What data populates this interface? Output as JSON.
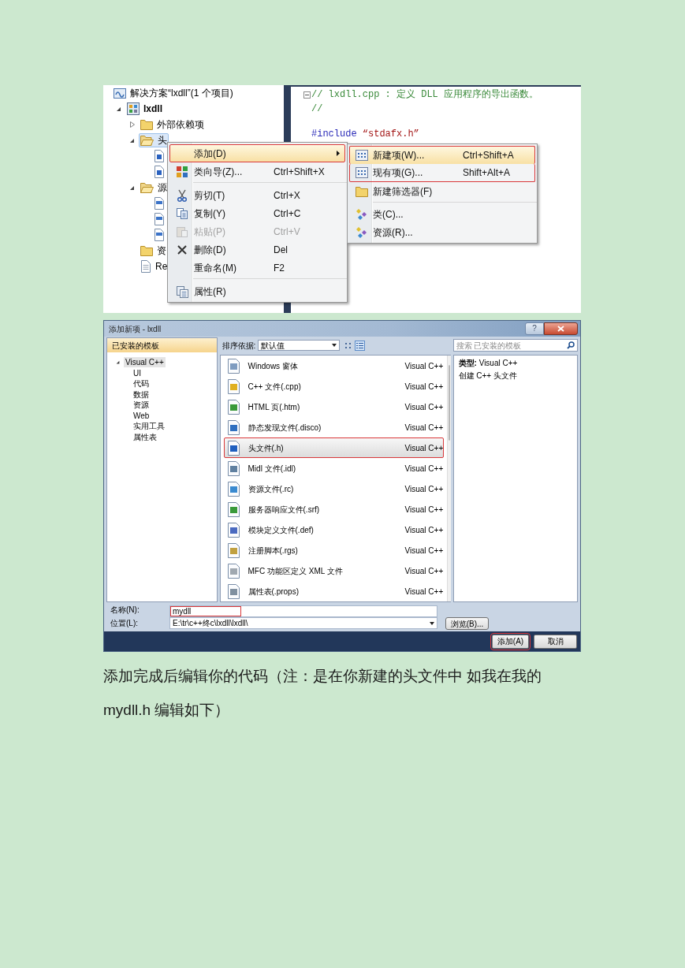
{
  "solution_explorer": {
    "items": [
      {
        "kind": "solution",
        "label": "解决方案“lxdll”(1 个项目)",
        "selected": false,
        "children": [
          {
            "kind": "project",
            "label": "lxdll",
            "expanded": true,
            "selected": false,
            "children": [
              {
                "kind": "folder",
                "label": "外部依赖项",
                "expanded": false,
                "selected": false
              },
              {
                "kind": "folder",
                "label": "头",
                "expanded": true,
                "selected": true,
                "children": [
                  {
                    "kind": "header",
                    "selected": false
                  },
                  {
                    "kind": "header",
                    "selected": false
                  }
                ]
              },
              {
                "kind": "folder",
                "label": "源",
                "expanded": true,
                "selected": false,
                "children": [
                  {
                    "kind": "cpp",
                    "selected": false
                  },
                  {
                    "kind": "cpp",
                    "selected": false
                  },
                  {
                    "kind": "cpp",
                    "selected": false
                  }
                ]
              },
              {
                "kind": "folder",
                "label": "资",
                "selected": false
              },
              {
                "kind": "file",
                "label": "Re",
                "selected": false
              }
            ]
          }
        ]
      }
    ]
  },
  "editor": {
    "lines": [
      {
        "kind": "comment",
        "text": "// lxdll.cpp : 定义 DLL 应用程序的导出函数。",
        "foldable": true
      },
      {
        "kind": "comment",
        "text": "//"
      },
      {
        "kind": "include",
        "keyword": "#include",
        "text": "“stdafx.h”"
      }
    ]
  },
  "context_menu": {
    "items": [
      {
        "kind": "submenu",
        "label": "添加(D)",
        "selected": true,
        "disabled": false,
        "annotated": true
      },
      {
        "kind": "wizard",
        "label": "类向导(Z)...",
        "shortcut": "Ctrl+Shift+X",
        "selected": false,
        "disabled": false,
        "annotated": false
      },
      {
        "kind": "separator"
      },
      {
        "kind": "cut",
        "label": "剪切(T)",
        "shortcut": "Ctrl+X",
        "selected": false,
        "disabled": false,
        "annotated": false
      },
      {
        "kind": "copy",
        "label": "复制(Y)",
        "shortcut": "Ctrl+C",
        "selected": false,
        "disabled": false,
        "annotated": false
      },
      {
        "kind": "paste",
        "label": "粘贴(P)",
        "shortcut": "Ctrl+V",
        "selected": false,
        "disabled": true,
        "annotated": false
      },
      {
        "kind": "delete",
        "label": "删除(D)",
        "shortcut": "Del",
        "selected": false,
        "disabled": false,
        "annotated": false
      },
      {
        "kind": "plain",
        "label": "重命名(M)",
        "shortcut": "F2",
        "selected": false,
        "disabled": false,
        "annotated": false
      },
      {
        "kind": "separator"
      },
      {
        "kind": "properties",
        "label": "属性(R)",
        "selected": false,
        "disabled": false,
        "annotated": false
      }
    ]
  },
  "submenu": {
    "items": [
      {
        "kind": "new_item",
        "label": "新建项(W)...",
        "shortcut": "Ctrl+Shift+A",
        "selected": true,
        "disabled": false,
        "annotated": true
      },
      {
        "kind": "existing_item",
        "label": "现有项(G)...",
        "shortcut": "Shift+Alt+A",
        "selected": false,
        "disabled": false,
        "annotated": true
      },
      {
        "kind": "filter",
        "label": "新建筛选器(F)",
        "selected": false,
        "disabled": false,
        "annotated": false
      },
      {
        "kind": "separator"
      },
      {
        "kind": "class",
        "label": "类(C)...",
        "selected": false,
        "disabled": false,
        "annotated": false
      },
      {
        "kind": "resource",
        "label": "资源(R)...",
        "selected": false,
        "disabled": false,
        "annotated": false
      }
    ]
  },
  "dialog": {
    "title": "添加新项 - lxdll",
    "help_button": "?",
    "templates_header": "已安装的模板",
    "template_tree": [
      {
        "label": "Visual C++",
        "expanded": true,
        "selected": true,
        "children": [
          {
            "label": "UI",
            "selected": false
          },
          {
            "label": "代码",
            "selected": false
          },
          {
            "label": "数据",
            "selected": false
          },
          {
            "label": "资源",
            "selected": false
          },
          {
            "label": "Web",
            "selected": false
          },
          {
            "label": "实用工具",
            "selected": false
          },
          {
            "label": "属性表",
            "selected": false
          }
        ]
      }
    ],
    "sort_label": "排序依据:",
    "sort_value": "默认值",
    "view_buttons": [
      {
        "selected": false
      },
      {
        "selected": true
      }
    ],
    "search_placeholder": "搜索 已安装的模板",
    "templates": [
      {
        "kind": "form",
        "name": "Windows 窗体",
        "language": "Visual C++",
        "selected": false,
        "annotated": false
      },
      {
        "kind": "cpp",
        "name": "C++ 文件(.cpp)",
        "language": "Visual C++",
        "selected": false,
        "annotated": false
      },
      {
        "kind": "html",
        "name": "HTML 页(.htm)",
        "language": "Visual C++",
        "selected": false,
        "annotated": false
      },
      {
        "kind": "disco",
        "name": "静态发现文件(.disco)",
        "language": "Visual C++",
        "selected": false,
        "annotated": false
      },
      {
        "kind": "header",
        "name": "头文件(.h)",
        "language": "Visual C++",
        "selected": true,
        "annotated": true
      },
      {
        "kind": "idl",
        "name": "Midl 文件(.idl)",
        "language": "Visual C++",
        "selected": false,
        "annotated": false
      },
      {
        "kind": "rc",
        "name": "资源文件(.rc)",
        "language": "Visual C++",
        "selected": false,
        "annotated": false
      },
      {
        "kind": "srf",
        "name": "服务器响应文件(.srf)",
        "language": "Visual C++",
        "selected": false,
        "annotated": false
      },
      {
        "kind": "def",
        "name": "模块定义文件(.def)",
        "language": "Visual C++",
        "selected": false,
        "annotated": false
      },
      {
        "kind": "rgs",
        "name": "注册脚本(.rgs)",
        "language": "Visual C++",
        "selected": false,
        "annotated": false
      },
      {
        "kind": "xml",
        "name": "MFC 功能区定义 XML 文件",
        "language": "Visual C++",
        "selected": false,
        "annotated": false
      },
      {
        "kind": "props",
        "name": "属性表(.props)",
        "language": "Visual C++",
        "selected": false,
        "annotated": false
      }
    ],
    "details": {
      "type_line": "**类型:** Visual C++",
      "description": "创建 C++ 头文件"
    },
    "name_label": "名称(N):",
    "name_value": "mydll",
    "name_annotated": true,
    "location_label": "位置(L):",
    "location_value": "E:\\tr\\c++终c\\lxdll\\lxdll\\",
    "browse_button": "浏览(B)...",
    "buttons": [
      {
        "label": "添加(A)",
        "annotated": true
      },
      {
        "label": "取消",
        "annotated": false
      }
    ]
  },
  "paragraph": "添加完成后编辑你的代码（注：是在你新建的头文件中 如我在我的mydll.h 编辑如下）"
}
